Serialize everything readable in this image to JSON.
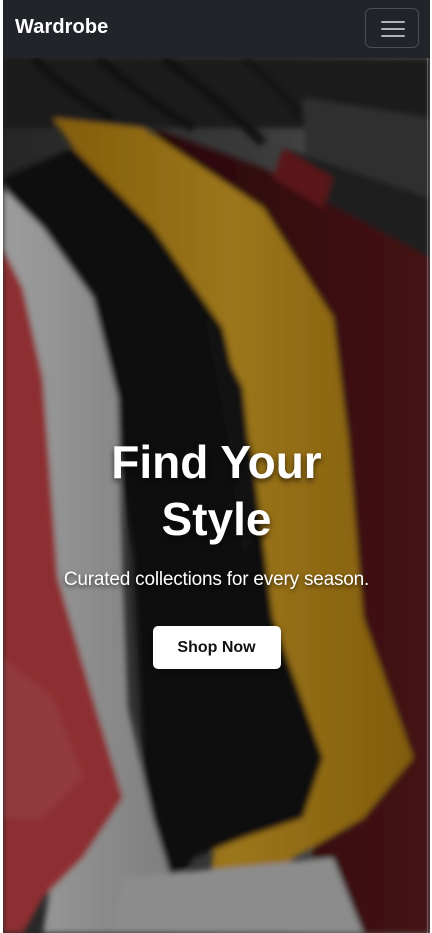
{
  "navbar": {
    "brand": "Wardrobe",
    "menu_icon": "hamburger-menu-icon"
  },
  "hero": {
    "title": "Find Your Style",
    "subtitle": "Curated collections for every season.",
    "cta_label": "Shop Now",
    "background_image": "clothes-rack-photo"
  },
  "colors": {
    "navbar_bg": "#212529",
    "cta_bg": "#ffffff",
    "shirt_red": "#d9484e",
    "shirt_white": "#e6e6e6",
    "shirt_black": "#141414",
    "shirt_yellow": "#e3a81c",
    "shirt_maroon": "#5a1518"
  }
}
